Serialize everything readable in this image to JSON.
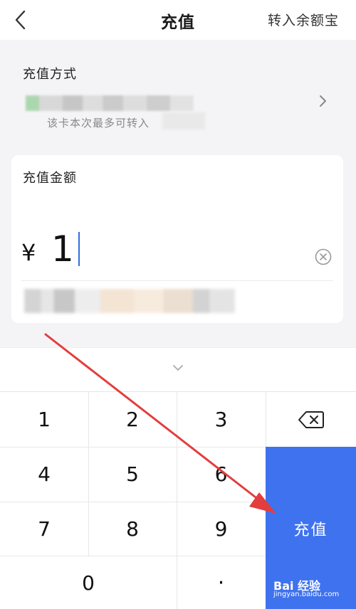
{
  "header": {
    "title": "充值",
    "right_link": "转入余额宝"
  },
  "method": {
    "label": "充值方式",
    "limit_text": "该卡本次最多可转入"
  },
  "amount": {
    "label": "充值金额",
    "currency": "¥",
    "value": "1"
  },
  "keypad": {
    "keys": [
      "1",
      "2",
      "3",
      "4",
      "5",
      "6",
      "7",
      "8",
      "9",
      "0",
      "·"
    ],
    "submit_label": "充值"
  },
  "watermark": {
    "brand": "Bai 经验",
    "url": "jingyan.baidu.com"
  },
  "colors": {
    "accent": "#3f72ef",
    "arrow": "#e33d3d"
  },
  "icons": [
    "back-arrow-icon",
    "chevron-right-icon",
    "clear-icon",
    "chevron-down-icon",
    "backspace-icon"
  ]
}
